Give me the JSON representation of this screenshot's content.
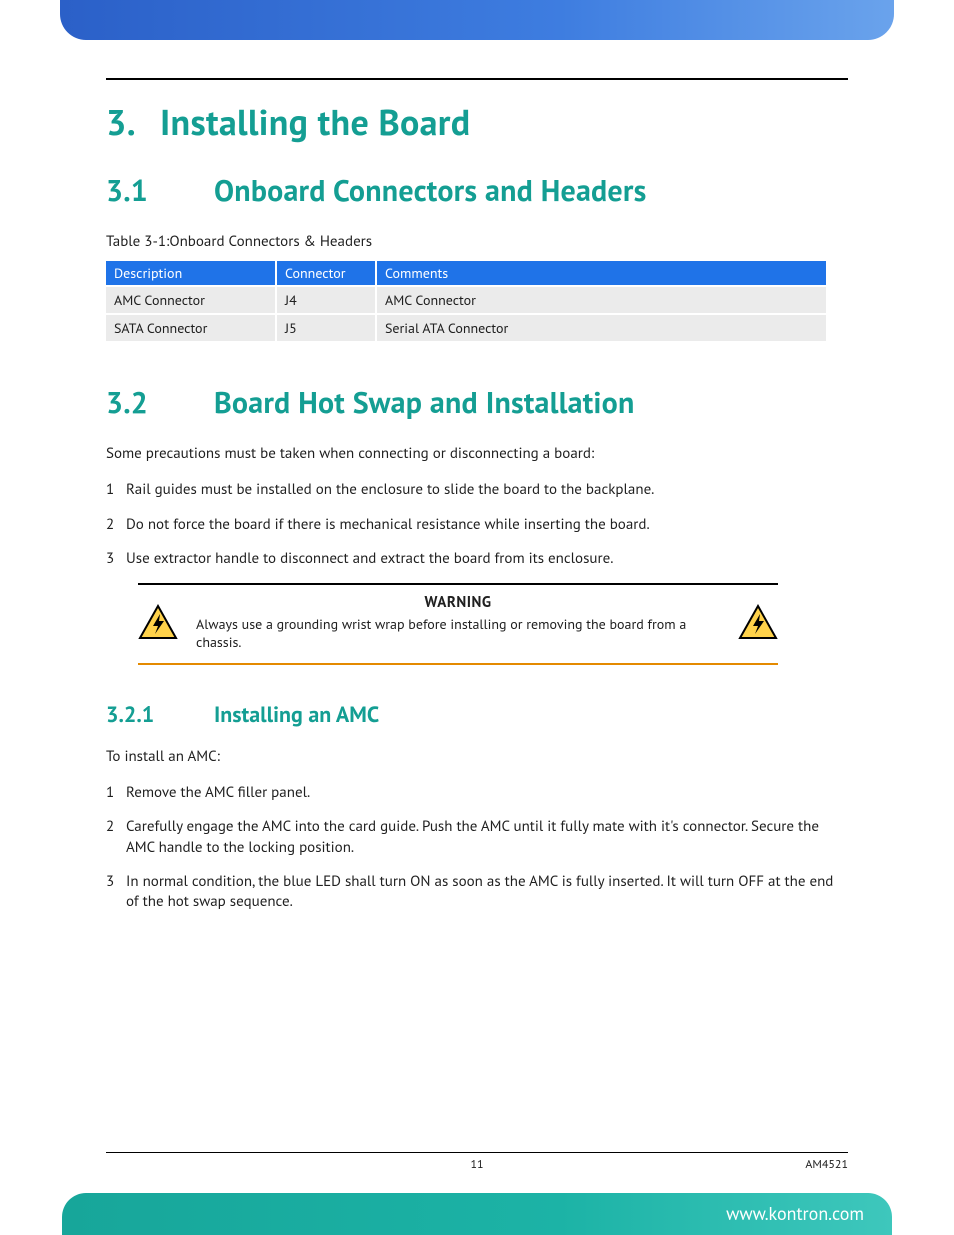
{
  "chapter": {
    "num": "3.",
    "title": "Installing the Board"
  },
  "sections": {
    "s1": {
      "num": "3.1",
      "title": "Onboard Connectors and Headers"
    },
    "s2": {
      "num": "3.2",
      "title": "Board Hot Swap and Installation"
    },
    "s2_1": {
      "num": "3.2.1",
      "title": "Installing an AMC"
    }
  },
  "table": {
    "caption": "Table 3-1:Onboard Connectors & Headers",
    "headers": {
      "a": "Description",
      "b": "Connector",
      "c": "Comments"
    },
    "rows": [
      {
        "a": "AMC Connector",
        "b": "J4",
        "c": "AMC Connector"
      },
      {
        "a": "SATA Connector",
        "b": "J5",
        "c": "Serial ATA Connector"
      }
    ]
  },
  "hotswap": {
    "intro": "Some precautions must be taken when connecting or disconnecting a board:",
    "steps": [
      "Rail guides must be installed on the enclosure to slide the board to the backplane.",
      "Do not force the board if there is mechanical resistance while inserting the board.",
      "Use extractor handle to disconnect and extract the board from its enclosure."
    ]
  },
  "warning": {
    "title": "WARNING",
    "body": "Always use a grounding wrist wrap before installing or removing the board from a chassis.",
    "icon": "esd-warning-icon"
  },
  "install_amc": {
    "intro": "To install an AMC:",
    "steps": [
      "Remove the AMC filler panel.",
      "Carefully engage the AMC into the card guide. Push the AMC until it fully mate with it's connector. Secure the AMC handle to the locking position.",
      "In normal condition, the blue LED shall turn ON as soon as the AMC is fully inserted. It will turn OFF at the end of the hot swap sequence."
    ]
  },
  "footer": {
    "page": "11",
    "doc": "AM4521",
    "url": "www.kontron.com"
  }
}
